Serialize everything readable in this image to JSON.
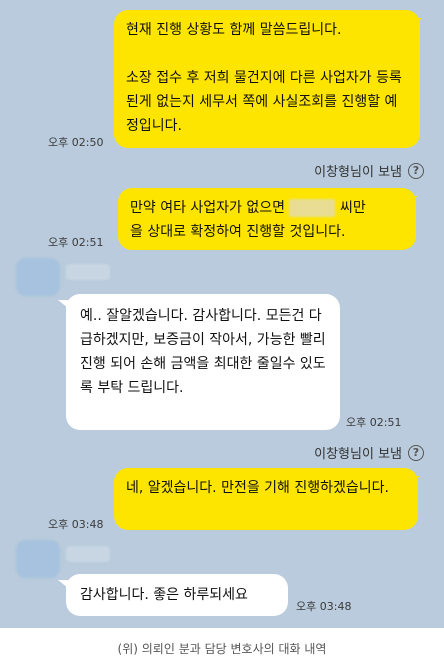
{
  "messages": {
    "m1": {
      "text": "현재 진행 상황도 함께 말씀드립니다.\n\n소장 접수 후 저희 물건지에 다른 사업자가 등록된게 없는지 세무서 쪽에 사실조회를 진행할 예정입니다.",
      "time": "오후 02:50"
    },
    "sender1": "이창형님이 보냄",
    "m2": {
      "text_before": "만약 여타 사업자가 없으면",
      "text_after": "씨만",
      "text_line2": "을 상대로 확정하여 진행할 것입니다.",
      "time": "오후 02:51"
    },
    "m3": {
      "text": "예.. 잘알겠습니다. 감사합니다. 모든건 다 급하겠지만, 보증금이 작아서, 가능한 빨리 진행 되어 손해 금액을 최대한 줄일수 있도록 부탁 드립니다.",
      "time": "오후 02:51"
    },
    "sender2": "이창형님이 보냄",
    "m4": {
      "text": "네, 알겠습니다. 만전을 기해 진행하겠습니다.",
      "time": "오후 03:48"
    },
    "m5": {
      "text": "감사합니다. 좋은 하루되세요",
      "time": "오후 03:48"
    }
  },
  "help_glyph": "?",
  "caption": "(위) 의뢰인 분과 담당 변호사의 대화 내역",
  "colors": {
    "background": "#b9cbdc",
    "my_bubble": "#fee500",
    "their_bubble": "#ffffff"
  }
}
